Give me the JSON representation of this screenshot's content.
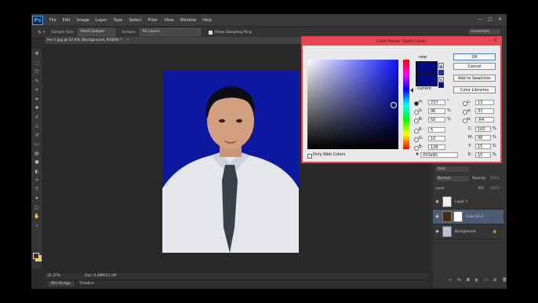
{
  "app": {
    "logo": "Ps",
    "menus": [
      "File",
      "Edit",
      "Image",
      "Layer",
      "Type",
      "Select",
      "Filter",
      "View",
      "Window",
      "Help"
    ],
    "window_controls": [
      "—",
      "□",
      "✕"
    ]
  },
  "options": {
    "sample_size_label": "Sample Size:",
    "sample_size_value": "Point Sample",
    "sample_label": "Sample:",
    "sample_value": "All Layers",
    "show_ring_label": "Show Sampling Ring",
    "workspace": "Essentials"
  },
  "document": {
    "tab_title": "tes 1.jpg @ 32.4% (Background, RGB/8) *",
    "zoom": "32.37%",
    "doc_size": "Doc: 5.49M/12.1M"
  },
  "bottom_tabs": [
    "Mini Bridge",
    "Timeline"
  ],
  "layers": {
    "kind_label": "Kind",
    "blend_mode": "Normal",
    "opacity_label": "Opacity:",
    "opacity_value": "100%",
    "lock_label": "Lock:",
    "fill_label": "Fill:",
    "fill_value": "100%",
    "items": [
      {
        "name": "Layer 1"
      },
      {
        "name": "Color Fill 1"
      },
      {
        "name": "Background"
      }
    ]
  },
  "color_picker": {
    "title": "Color Picker (Solid Color)",
    "new_label": "new",
    "current_label": "current",
    "new_color": "#050a80",
    "current_color": "#050a80",
    "ok": "OK",
    "cancel": "Cancel",
    "add_to_swatches": "Add to Swatches",
    "color_libraries": "Color Libraries",
    "only_web_colors": "Only Web Colors",
    "hsb": [
      {
        "label": "H:",
        "value": "237",
        "unit": "°"
      },
      {
        "label": "S:",
        "value": "96",
        "unit": "%"
      },
      {
        "label": "B:",
        "value": "50",
        "unit": "%"
      }
    ],
    "rgb": [
      {
        "label": "R:",
        "value": "5"
      },
      {
        "label": "G:",
        "value": "10"
      },
      {
        "label": "B:",
        "value": "128"
      }
    ],
    "lab": [
      {
        "label": "L:",
        "value": "13"
      },
      {
        "label": "a:",
        "value": "37"
      },
      {
        "label": "b:",
        "value": "-64"
      }
    ],
    "cmyk": [
      {
        "label": "C:",
        "value": "100",
        "unit": "%"
      },
      {
        "label": "M:",
        "value": "98",
        "unit": "%"
      },
      {
        "label": "Y:",
        "value": "15",
        "unit": "%"
      },
      {
        "label": "K:",
        "value": "15",
        "unit": "%"
      }
    ],
    "hex_label": "#",
    "hex_value": "050a80"
  }
}
